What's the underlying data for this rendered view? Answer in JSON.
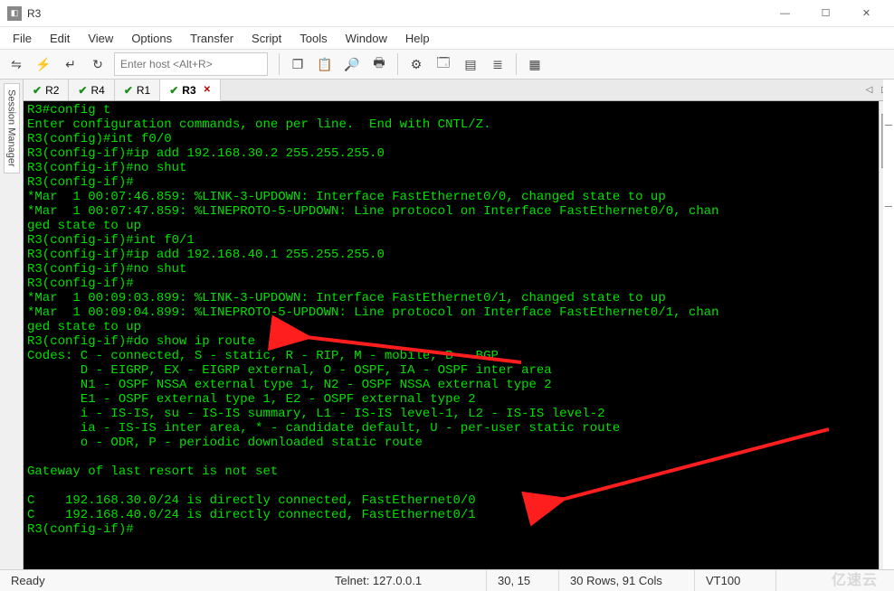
{
  "window": {
    "title": "R3"
  },
  "menu": [
    "File",
    "Edit",
    "View",
    "Options",
    "Transfer",
    "Script",
    "Tools",
    "Window",
    "Help"
  ],
  "toolbar": {
    "host_placeholder": "Enter host <Alt+R>",
    "icons": [
      {
        "name": "session-icon",
        "glyph": "⇋"
      },
      {
        "name": "quick-connect-icon",
        "glyph": "⚡"
      },
      {
        "name": "connect-icon",
        "glyph": "↵"
      },
      {
        "name": "reconnect-icon",
        "glyph": "↻"
      }
    ],
    "icons2": [
      {
        "name": "copy-icon",
        "glyph": "❐"
      },
      {
        "name": "paste-icon",
        "glyph": "📋"
      },
      {
        "name": "find-icon",
        "glyph": "🔎"
      },
      {
        "name": "print-icon",
        "glyph": "🖶"
      },
      {
        "name": "settings-icon",
        "glyph": "⚙"
      },
      {
        "name": "font-icon",
        "glyph": "🗔"
      },
      {
        "name": "colors-icon",
        "glyph": "▤"
      },
      {
        "name": "logging-icon",
        "glyph": "≣"
      },
      {
        "name": "hex-icon",
        "glyph": "▦"
      }
    ]
  },
  "side": {
    "label": "Session Manager"
  },
  "tabs": [
    {
      "label": "R2",
      "closeable": false
    },
    {
      "label": "R4",
      "closeable": false
    },
    {
      "label": "R1",
      "closeable": false
    },
    {
      "label": "R3",
      "closeable": true,
      "active": true
    }
  ],
  "terminal_lines": [
    "R3#config t",
    "Enter configuration commands, one per line.  End with CNTL/Z.",
    "R3(config)#int f0/0",
    "R3(config-if)#ip add 192.168.30.2 255.255.255.0",
    "R3(config-if)#no shut",
    "R3(config-if)#",
    "*Mar  1 00:07:46.859: %LINK-3-UPDOWN: Interface FastEthernet0/0, changed state to up",
    "*Mar  1 00:07:47.859: %LINEPROTO-5-UPDOWN: Line protocol on Interface FastEthernet0/0, chan",
    "ged state to up",
    "R3(config-if)#int f0/1",
    "R3(config-if)#ip add 192.168.40.1 255.255.255.0",
    "R3(config-if)#no shut",
    "R3(config-if)#",
    "*Mar  1 00:09:03.899: %LINK-3-UPDOWN: Interface FastEthernet0/1, changed state to up",
    "*Mar  1 00:09:04.899: %LINEPROTO-5-UPDOWN: Line protocol on Interface FastEthernet0/1, chan",
    "ged state to up",
    "R3(config-if)#do show ip route",
    "Codes: C - connected, S - static, R - RIP, M - mobile, B - BGP",
    "       D - EIGRP, EX - EIGRP external, O - OSPF, IA - OSPF inter area",
    "       N1 - OSPF NSSA external type 1, N2 - OSPF NSSA external type 2",
    "       E1 - OSPF external type 1, E2 - OSPF external type 2",
    "       i - IS-IS, su - IS-IS summary, L1 - IS-IS level-1, L2 - IS-IS level-2",
    "       ia - IS-IS inter area, * - candidate default, U - per-user static route",
    "       o - ODR, P - periodic downloaded static route",
    "",
    "Gateway of last resort is not set",
    "",
    "C    192.168.30.0/24 is directly connected, FastEthernet0/0",
    "C    192.168.40.0/24 is directly connected, FastEthernet0/1",
    "R3(config-if)#"
  ],
  "status": {
    "ready": "Ready",
    "conn": "Telnet: 127.0.0.1",
    "pos": "30, 15",
    "size": "30 Rows, 91 Cols",
    "emul": "VT100",
    "watermark": "亿速云"
  }
}
